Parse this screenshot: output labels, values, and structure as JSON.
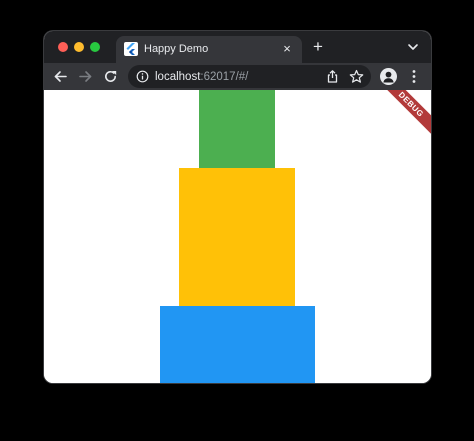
{
  "tab": {
    "title": "Happy Demo",
    "close_glyph": "×"
  },
  "new_tab_glyph": "+",
  "address": {
    "host": "localhost",
    "rest": ":62017/#/"
  },
  "debug_banner": "DEBUG",
  "icons": {
    "favicon": "flutter-icon",
    "back": "arrow-left-icon",
    "forward": "arrow-right-icon",
    "reload": "reload-icon",
    "site_info": "info-icon",
    "share": "share-icon",
    "bookmark": "star-icon",
    "profile": "profile-icon",
    "menu": "kebab-menu-icon",
    "tab_search": "chevron-down-icon"
  },
  "colors": {
    "green_block": "#4caf50",
    "yellow_block": "#ffc107",
    "blue_block": "#2196f3",
    "debug_ribbon": "#b23a3a",
    "titlebar": "#202124",
    "toolbar": "#35363a"
  }
}
